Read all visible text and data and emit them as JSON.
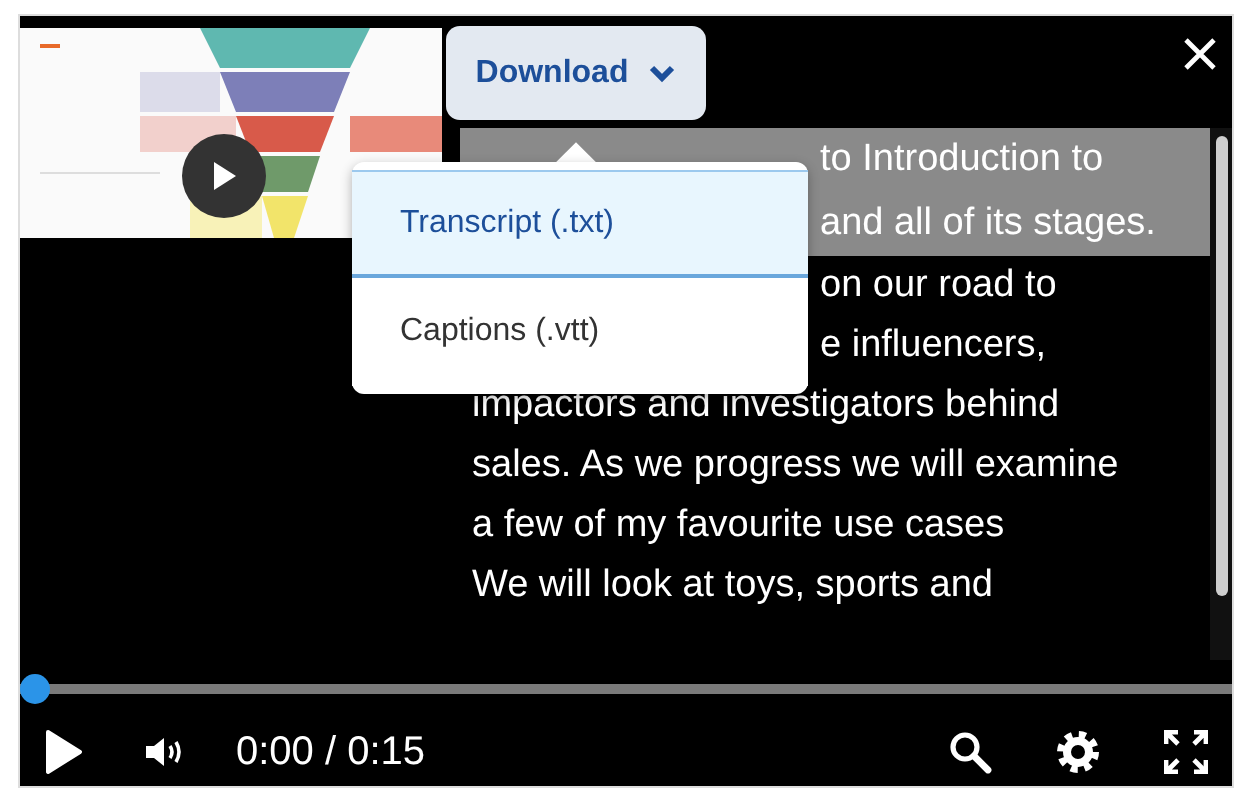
{
  "download_button": {
    "label": "Download"
  },
  "download_menu": {
    "open": true,
    "items": [
      {
        "label": "Transcript (.txt)",
        "selected": true
      },
      {
        "label": "Captions (.vtt)",
        "selected": false
      }
    ]
  },
  "transcript": {
    "lines": [
      {
        "text": "to Introduction to",
        "kind": "partial",
        "highlighted": true
      },
      {
        "text": "and all of its stages.",
        "kind": "partial",
        "highlighted": true
      },
      {
        "text": "on our road to",
        "kind": "partial",
        "highlighted": false
      },
      {
        "text": "e influencers,",
        "kind": "partial",
        "highlighted": false
      },
      {
        "text": "impactors and investigators behind",
        "kind": "full",
        "highlighted": false
      },
      {
        "text": "sales. As we progress we will examine",
        "kind": "full",
        "highlighted": false
      },
      {
        "text": "a few of my favourite use cases",
        "kind": "full",
        "highlighted": false
      },
      {
        "text": "We will look at toys, sports and",
        "kind": "full",
        "highlighted": false
      }
    ]
  },
  "progress": {
    "level": 0
  },
  "time": "0:00 / 0:15"
}
